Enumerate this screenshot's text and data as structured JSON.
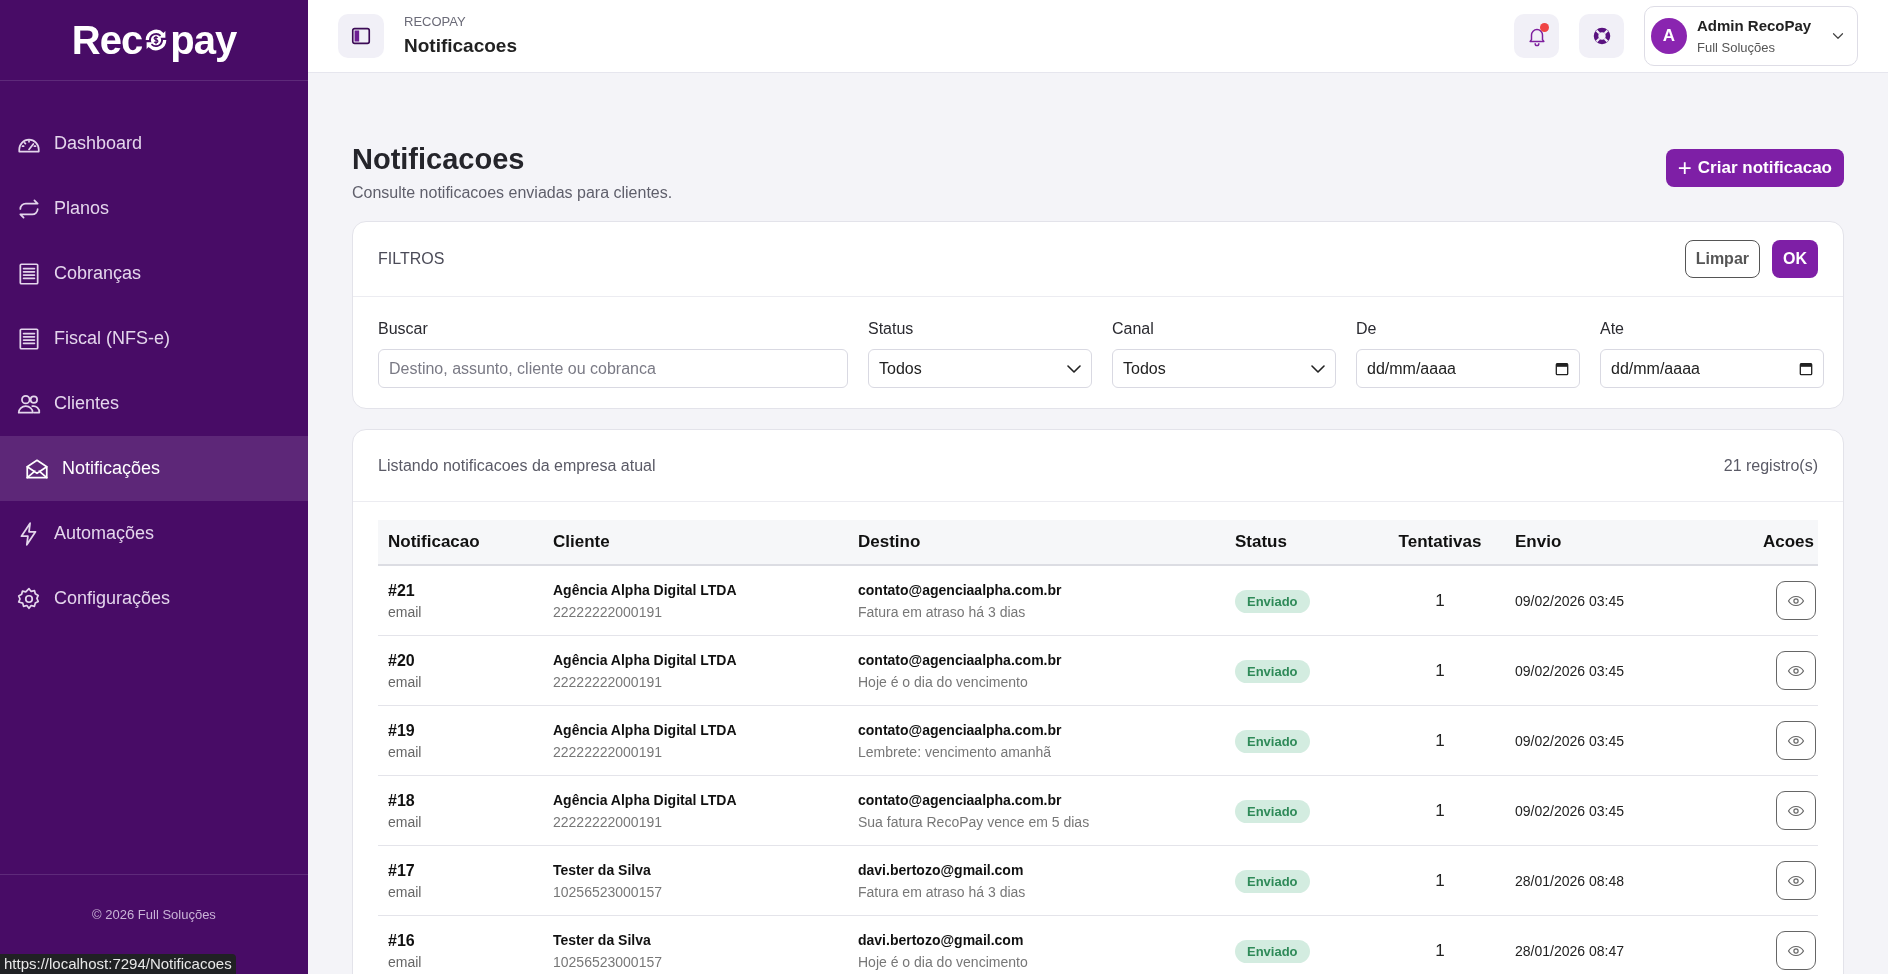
{
  "sidebar": {
    "logo": {
      "before": "Rec",
      "after": "pay"
    },
    "items": [
      {
        "label": "Dashboard",
        "selected": false
      },
      {
        "label": "Planos",
        "selected": false
      },
      {
        "label": "Cobranças",
        "selected": false
      },
      {
        "label": "Fiscal (NFS-e)",
        "selected": false
      },
      {
        "label": "Clientes",
        "selected": false
      },
      {
        "label": "Notificações",
        "selected": true
      },
      {
        "label": "Automações",
        "selected": false
      },
      {
        "label": "Configurações",
        "selected": false
      }
    ],
    "footer": "© 2026 Full Soluções"
  },
  "header": {
    "breadcrumb": "RECOPAY",
    "title": "Notificacoes",
    "has_unread": true,
    "user": {
      "initial": "A",
      "name": "Admin RecoPay",
      "company": "Full Soluções"
    }
  },
  "page": {
    "title": "Notificacoes",
    "subtitle": "Consulte notificacoes enviadas para clientes.",
    "create_button": {
      "icon": "+",
      "label": "Criar notificacao"
    }
  },
  "filters": {
    "title": "FILTROS",
    "clear_button": "Limpar",
    "ok_button": "OK",
    "fields": [
      {
        "kind": "text",
        "label": "Buscar",
        "placeholder": "Destino, assunto, cliente ou cobranca"
      },
      {
        "kind": "select",
        "label": "Status",
        "value": "Todos"
      },
      {
        "kind": "select",
        "label": "Canal",
        "value": "Todos"
      },
      {
        "kind": "date",
        "label": "De",
        "value": "dd/mm/aaaa"
      },
      {
        "kind": "date",
        "label": "Ate",
        "value": "dd/mm/aaaa"
      }
    ]
  },
  "list": {
    "caption": "Listando notificacoes da empresa atual",
    "count": "21 registro(s)",
    "columns": [
      "Notificacao",
      "Cliente",
      "Destino",
      "Status",
      "Tentativas",
      "Envio",
      "Acoes"
    ],
    "rows": [
      {
        "id": "#21",
        "channel": "email",
        "client": "Agência Alpha Digital LTDA",
        "document": "22222222000191",
        "destination": "contato@agenciaalpha.com.br",
        "subject": "Fatura em atraso há 3 dias",
        "status": {
          "kind": "sent",
          "label": "Enviado"
        },
        "attempts": "1",
        "sent_at": "09/02/2026 03:45"
      },
      {
        "id": "#20",
        "channel": "email",
        "client": "Agência Alpha Digital LTDA",
        "document": "22222222000191",
        "destination": "contato@agenciaalpha.com.br",
        "subject": "Hoje é o dia do vencimento",
        "status": {
          "kind": "sent",
          "label": "Enviado"
        },
        "attempts": "1",
        "sent_at": "09/02/2026 03:45"
      },
      {
        "id": "#19",
        "channel": "email",
        "client": "Agência Alpha Digital LTDA",
        "document": "22222222000191",
        "destination": "contato@agenciaalpha.com.br",
        "subject": "Lembrete: vencimento amanhã",
        "status": {
          "kind": "sent",
          "label": "Enviado"
        },
        "attempts": "1",
        "sent_at": "09/02/2026 03:45"
      },
      {
        "id": "#18",
        "channel": "email",
        "client": "Agência Alpha Digital LTDA",
        "document": "22222222000191",
        "destination": "contato@agenciaalpha.com.br",
        "subject": "Sua fatura RecoPay vence em 5 dias",
        "status": {
          "kind": "sent",
          "label": "Enviado"
        },
        "attempts": "1",
        "sent_at": "09/02/2026 03:45"
      },
      {
        "id": "#17",
        "channel": "email",
        "client": "Tester da Silva",
        "document": "10256523000157",
        "destination": "davi.bertozo@gmail.com",
        "subject": "Fatura em atraso há 3 dias",
        "status": {
          "kind": "sent",
          "label": "Enviado"
        },
        "attempts": "1",
        "sent_at": "28/01/2026 08:48"
      },
      {
        "id": "#16",
        "channel": "email",
        "client": "Tester da Silva",
        "document": "10256523000157",
        "destination": "davi.bertozo@gmail.com",
        "subject": "Hoje é o dia do vencimento",
        "status": {
          "kind": "sent",
          "label": "Enviado"
        },
        "attempts": "1",
        "sent_at": "28/01/2026 08:47"
      }
    ]
  },
  "status_bar": {
    "url": "https://localhost:7294/Notificacoes"
  }
}
